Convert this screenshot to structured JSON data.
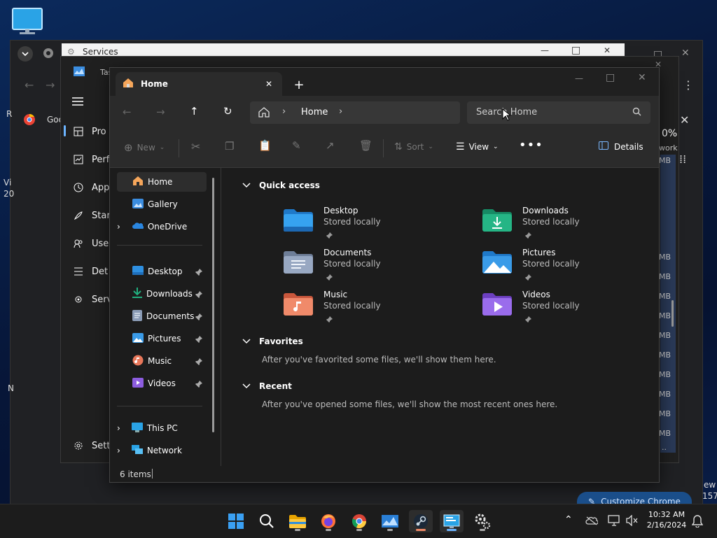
{
  "services_window": {
    "title": "Services"
  },
  "task_manager": {
    "title_fragment": "Tas",
    "nav": [
      "Pro",
      "Perf",
      "App",
      "Star",
      "Use",
      "Det",
      "Serv"
    ],
    "settings_fragment": "Sett",
    "right_edge": {
      "percent": "0%",
      "network_fragment": "work",
      "mb": "MB",
      "dots": ".."
    }
  },
  "chrome_bg": {
    "bookmark_fragment": "Goo",
    "left_edge": [
      "R",
      "Vi",
      "20",
      "N"
    ],
    "bottom_right": [
      "ew",
      "157"
    ]
  },
  "explorer": {
    "tab_title": "Home",
    "breadcrumb": "Home",
    "search_placeholder": "Search Home",
    "toolbar": {
      "new_label": "New",
      "sort_label": "Sort",
      "view_label": "View",
      "details_label": "Details"
    },
    "sidebar": {
      "top": [
        {
          "label": "Home"
        },
        {
          "label": "Gallery"
        },
        {
          "label": "OneDrive"
        }
      ],
      "pinned": [
        {
          "label": "Desktop"
        },
        {
          "label": "Downloads"
        },
        {
          "label": "Documents"
        },
        {
          "label": "Pictures"
        },
        {
          "label": "Music"
        },
        {
          "label": "Videos"
        }
      ],
      "bottom": [
        {
          "label": "This PC"
        },
        {
          "label": "Network"
        }
      ]
    },
    "quick_access": {
      "heading": "Quick access",
      "items": [
        {
          "name": "Desktop",
          "sub": "Stored locally",
          "color": "#2e8fe0"
        },
        {
          "name": "Downloads",
          "sub": "Stored locally",
          "color": "#21a77c"
        },
        {
          "name": "Documents",
          "sub": "Stored locally",
          "color": "#8a9bb5"
        },
        {
          "name": "Pictures",
          "sub": "Stored locally",
          "color": "#3a9be8"
        },
        {
          "name": "Music",
          "sub": "Stored locally",
          "color": "#e8775a"
        },
        {
          "name": "Videos",
          "sub": "Stored locally",
          "color": "#8d5de0"
        }
      ]
    },
    "favorites": {
      "heading": "Favorites",
      "message": "After you've favorited some files, we'll show them here."
    },
    "recent": {
      "heading": "Recent",
      "message": "After you've opened some files, we'll show the most recent ones here."
    },
    "status": "6 items"
  },
  "customize_chrome": "Customize Chrome",
  "taskbar": {
    "time": "10:32 AM",
    "date": "2/16/2024"
  }
}
